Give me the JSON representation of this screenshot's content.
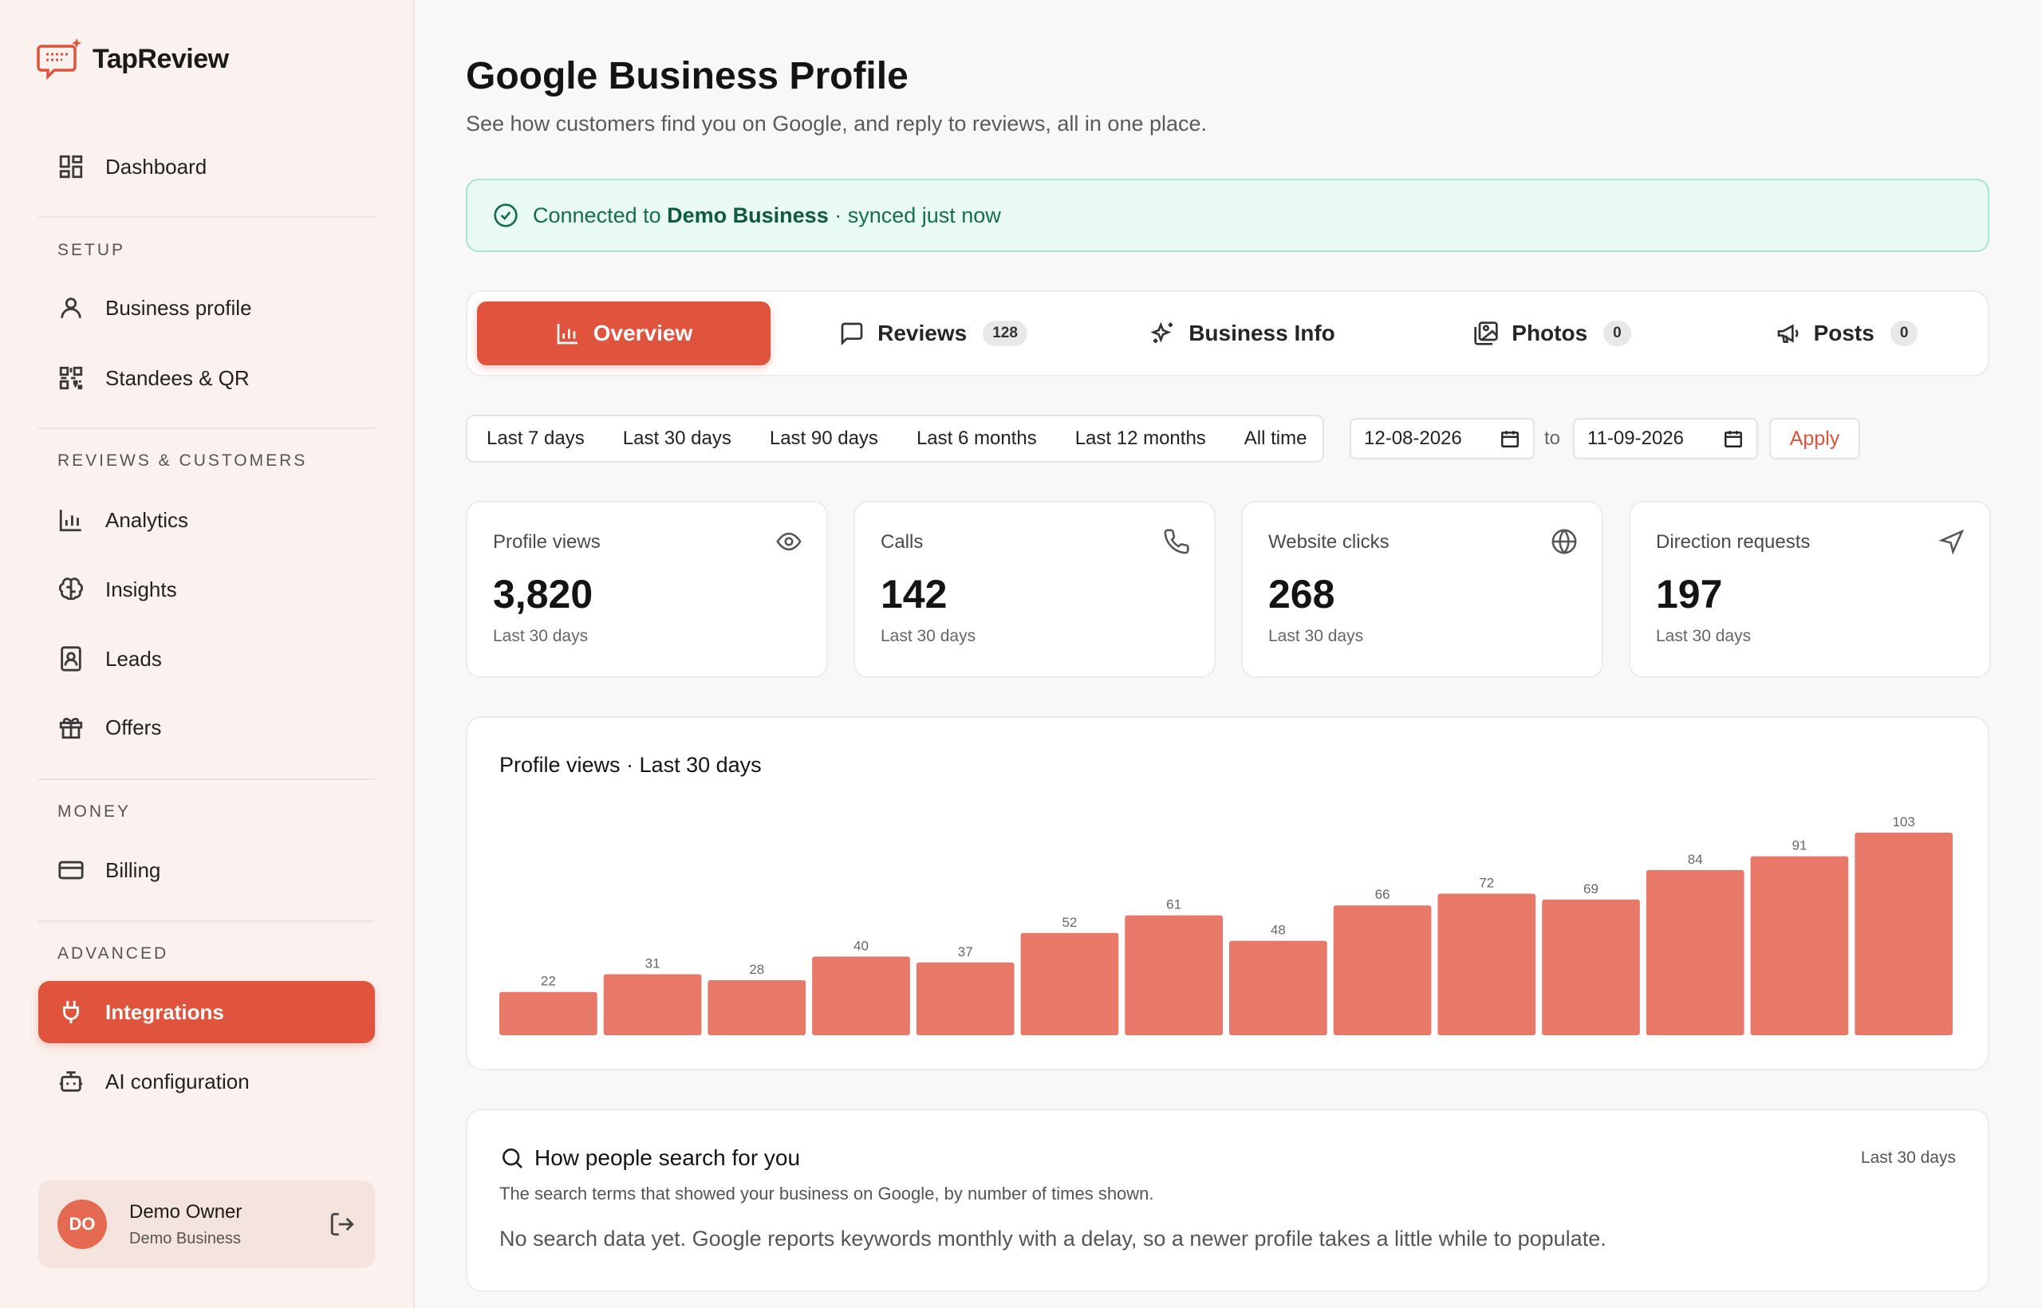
{
  "app": {
    "name": "TapReview"
  },
  "sidebar": {
    "dashboard": "Dashboard",
    "sections": {
      "setup": "SETUP",
      "reviews": "REVIEWS & CUSTOMERS",
      "money": "MONEY",
      "advanced": "ADVANCED"
    },
    "items": {
      "business_profile": "Business profile",
      "standees": "Standees & QR",
      "analytics": "Analytics",
      "insights": "Insights",
      "leads": "Leads",
      "offers": "Offers",
      "billing": "Billing",
      "integrations": "Integrations",
      "ai_config": "AI configuration"
    },
    "user": {
      "initials": "DO",
      "name": "Demo Owner",
      "business": "Demo Business"
    }
  },
  "page": {
    "title": "Google Business Profile",
    "subtitle": "See how customers find you on Google, and reply to reviews, all in one place."
  },
  "connection": {
    "prefix": "Connected to",
    "business": "Demo Business",
    "suffix": "· synced just now"
  },
  "tabs": {
    "overview": "Overview",
    "reviews": "Reviews",
    "reviews_count": "128",
    "business_info": "Business Info",
    "photos": "Photos",
    "photos_count": "0",
    "posts": "Posts",
    "posts_count": "0"
  },
  "ranges": [
    "Last 7 days",
    "Last 30 days",
    "Last 90 days",
    "Last 6 months",
    "Last 12 months",
    "All time"
  ],
  "date_range": {
    "from": "12-08-2026",
    "to_label": "to",
    "to": "11-09-2026",
    "apply": "Apply"
  },
  "stats": [
    {
      "label": "Profile views",
      "value": "3,820",
      "period": "Last 30 days",
      "icon": "eye-icon"
    },
    {
      "label": "Calls",
      "value": "142",
      "period": "Last 30 days",
      "icon": "phone-icon"
    },
    {
      "label": "Website clicks",
      "value": "268",
      "period": "Last 30 days",
      "icon": "globe-icon"
    },
    {
      "label": "Direction requests",
      "value": "197",
      "period": "Last 30 days",
      "icon": "navigation-icon"
    }
  ],
  "chart_data": {
    "type": "bar",
    "title": "Profile views · Last 30 days",
    "values": [
      22,
      31,
      28,
      40,
      37,
      52,
      61,
      48,
      66,
      72,
      69,
      84,
      91,
      103
    ],
    "color": "#e87968"
  },
  "search": {
    "title": "How people search for you",
    "period": "Last 30 days",
    "description": "The search terms that showed your business on Google, by number of times shown.",
    "empty": "No search data yet. Google reports keywords monthly with a delay, so a newer profile takes a little while to populate."
  },
  "colors": {
    "accent": "#e0533d",
    "success_bg": "#e8faf3",
    "success_text": "#166d4d"
  }
}
